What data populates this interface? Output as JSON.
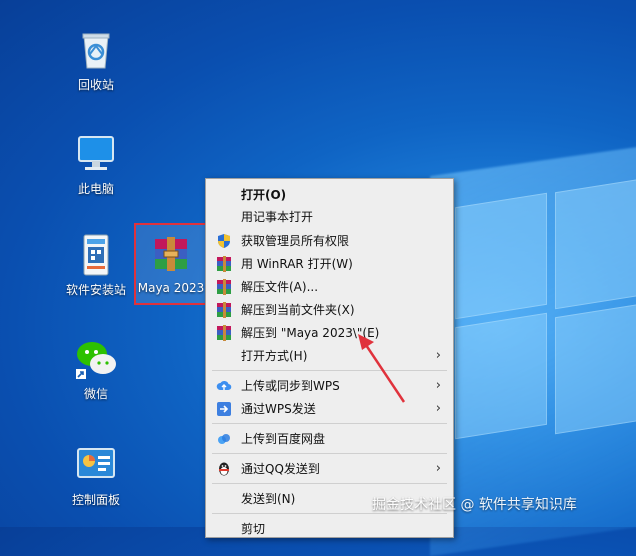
{
  "desktop": {
    "icons": [
      {
        "label": "回收站"
      },
      {
        "label": "此电脑"
      },
      {
        "label": "软件安装站"
      },
      {
        "label": "Maya 2023"
      },
      {
        "label": "微信"
      },
      {
        "label": "控制面板"
      }
    ]
  },
  "context_menu": {
    "items": [
      {
        "label": "打开(O)"
      },
      {
        "label": "用记事本打开"
      },
      {
        "label": "获取管理员所有权限"
      },
      {
        "label": "用 WinRAR 打开(W)"
      },
      {
        "label": "解压文件(A)..."
      },
      {
        "label": "解压到当前文件夹(X)"
      },
      {
        "label": "解压到 \"Maya 2023\\\"(E)"
      },
      {
        "label": "打开方式(H)"
      },
      {
        "label": "上传或同步到WPS"
      },
      {
        "label": "通过WPS发送"
      },
      {
        "label": "上传到百度网盘"
      },
      {
        "label": "通过QQ发送到"
      },
      {
        "label": "发送到(N)"
      },
      {
        "label": "剪切"
      }
    ],
    "submenu_arrow": "›"
  },
  "watermark": {
    "text": "掘金技术社区 @ 软件共享知识库"
  },
  "colors": {
    "annotation_red": "#e0323c",
    "menu_bg": "#eeeeee"
  }
}
